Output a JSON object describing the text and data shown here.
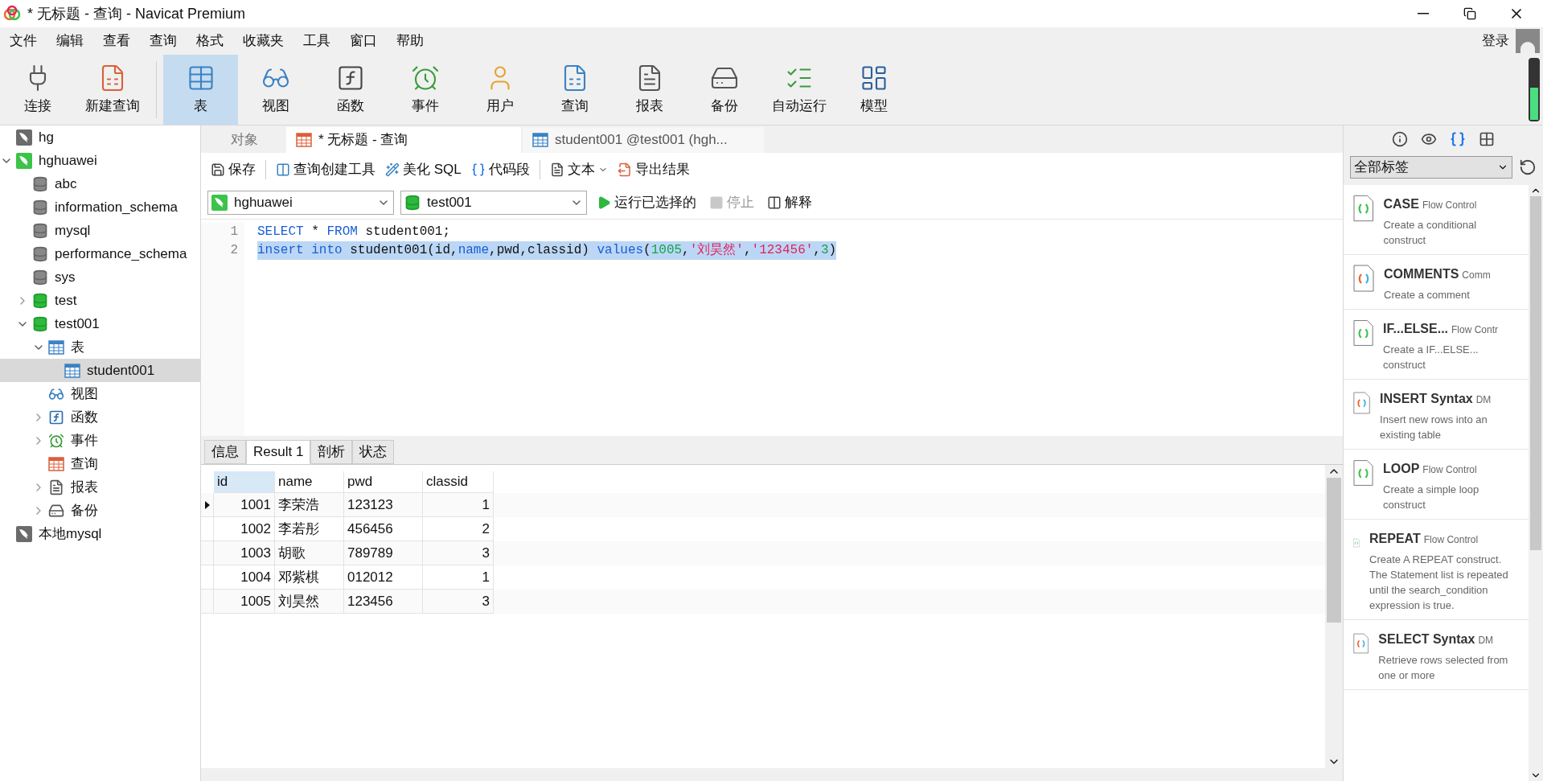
{
  "window": {
    "title": "* 无标题 - 查询 - Navicat Premium"
  },
  "menu": [
    "文件",
    "编辑",
    "查看",
    "查询",
    "格式",
    "收藏夹",
    "工具",
    "窗口",
    "帮助"
  ],
  "login": "登录",
  "toolbar": [
    {
      "kind": "connect",
      "label": "连接",
      "selected": false
    },
    {
      "kind": "new_query",
      "label": "新建查询",
      "selected": false
    },
    {
      "kind": "table",
      "label": "表",
      "selected": true
    },
    {
      "kind": "view",
      "label": "视图",
      "selected": false
    },
    {
      "kind": "function",
      "label": "函数",
      "selected": false
    },
    {
      "kind": "event",
      "label": "事件",
      "selected": false
    },
    {
      "kind": "user",
      "label": "用户",
      "selected": false
    },
    {
      "kind": "query",
      "label": "查询",
      "selected": false
    },
    {
      "kind": "report",
      "label": "报表",
      "selected": false
    },
    {
      "kind": "backup",
      "label": "备份",
      "selected": false
    },
    {
      "kind": "autorun",
      "label": "自动运行",
      "selected": false
    },
    {
      "kind": "model",
      "label": "模型",
      "selected": false
    }
  ],
  "tree": [
    {
      "kind": "connection",
      "label": "hg",
      "active": false,
      "selected": false
    },
    {
      "kind": "connection",
      "label": "hghuawei",
      "active": true,
      "expanded": true,
      "selected": false,
      "children": [
        {
          "kind": "database",
          "label": "abc",
          "active": false,
          "selected": false
        },
        {
          "kind": "database",
          "label": "information_schema",
          "active": false,
          "selected": false
        },
        {
          "kind": "database",
          "label": "mysql",
          "active": false,
          "selected": false
        },
        {
          "kind": "database",
          "label": "performance_schema",
          "active": false,
          "selected": false
        },
        {
          "kind": "database",
          "label": "sys",
          "active": false,
          "selected": false
        },
        {
          "kind": "database",
          "label": "test",
          "active": true,
          "expanded": false,
          "selected": false
        },
        {
          "kind": "database",
          "label": "test001",
          "active": true,
          "expanded": true,
          "selected": false,
          "children": [
            {
              "kind": "tables",
              "label": "表",
              "expanded": true,
              "selected": false,
              "children": [
                {
                  "kind": "table",
                  "label": "student001",
                  "selected": true
                }
              ]
            },
            {
              "kind": "views",
              "label": "视图",
              "selected": false
            },
            {
              "kind": "functions",
              "label": "函数",
              "expanded": false,
              "selected": false
            },
            {
              "kind": "events",
              "label": "事件",
              "expanded": false,
              "selected": false
            },
            {
              "kind": "queries",
              "label": "查询",
              "selected": false
            },
            {
              "kind": "reports",
              "label": "报表",
              "expanded": false,
              "selected": false
            },
            {
              "kind": "backups",
              "label": "备份",
              "expanded": false,
              "selected": false
            }
          ]
        }
      ]
    },
    {
      "kind": "connection",
      "label": "本地mysql",
      "active": false,
      "selected": false
    }
  ],
  "tabs": [
    {
      "kind": "objects",
      "label": "对象",
      "selected": false
    },
    {
      "kind": "query",
      "label": "* 无标题 - 查询",
      "selected": true
    },
    {
      "kind": "table",
      "label": "student001 @test001 (hgh...",
      "selected": false
    }
  ],
  "query_toolbar": [
    {
      "kind": "save",
      "label": "保存"
    },
    {
      "kind": "builder",
      "label": "查询创建工具"
    },
    {
      "kind": "beautify",
      "label": "美化 SQL"
    },
    {
      "kind": "snippet",
      "label": "代码段"
    },
    {
      "kind": "text",
      "label": "文本"
    },
    {
      "kind": "export",
      "label": "导出结果"
    }
  ],
  "connection_select": "hghuawei",
  "database_select": "test001",
  "run_actions": [
    {
      "kind": "run",
      "label": "运行已选择的",
      "disabled": false
    },
    {
      "kind": "stop",
      "label": "停止",
      "disabled": true
    },
    {
      "kind": "explain",
      "label": "解释",
      "disabled": false
    }
  ],
  "editor": {
    "lines": [
      {
        "number": "1",
        "selected": false,
        "tokens": [
          {
            "kind": "keyword",
            "text": "SELECT"
          },
          {
            "kind": "plain",
            "text": " * "
          },
          {
            "kind": "keyword",
            "text": "FROM"
          },
          {
            "kind": "plain",
            "text": " student001;"
          }
        ]
      },
      {
        "number": "2",
        "selected": true,
        "tokens": [
          {
            "kind": "keyword",
            "text": "insert into"
          },
          {
            "kind": "plain",
            "text": " student001(id,"
          },
          {
            "kind": "keyword",
            "text": "name"
          },
          {
            "kind": "plain",
            "text": ",pwd,classid) "
          },
          {
            "kind": "keyword",
            "text": "values"
          },
          {
            "kind": "plain",
            "text": "("
          },
          {
            "kind": "number",
            "text": "1005"
          },
          {
            "kind": "plain",
            "text": ","
          },
          {
            "kind": "string",
            "text": "'刘昊然'"
          },
          {
            "kind": "plain",
            "text": ","
          },
          {
            "kind": "string",
            "text": "'123456'"
          },
          {
            "kind": "plain",
            "text": ","
          },
          {
            "kind": "number",
            "text": "3"
          },
          {
            "kind": "plain",
            "text": ")"
          }
        ]
      }
    ]
  },
  "result_tabs": [
    {
      "label": "信息",
      "selected": false
    },
    {
      "label": "Result 1",
      "selected": true
    },
    {
      "label": "剖析",
      "selected": false
    },
    {
      "label": "状态",
      "selected": false
    }
  ],
  "table": {
    "columns": [
      {
        "label": "id",
        "selected": true,
        "kind": "number"
      },
      {
        "label": "name",
        "selected": false,
        "kind": "text"
      },
      {
        "label": "pwd",
        "selected": false,
        "kind": "text"
      },
      {
        "label": "classid",
        "selected": false,
        "kind": "number"
      }
    ],
    "rows": [
      {
        "current": true,
        "cells": [
          "1001",
          "李荣浩",
          "123123",
          "1"
        ]
      },
      {
        "current": false,
        "cells": [
          "1002",
          "李若彤",
          "456456",
          "2"
        ]
      },
      {
        "current": false,
        "cells": [
          "1003",
          "胡歌",
          "789789",
          "3"
        ]
      },
      {
        "current": false,
        "cells": [
          "1004",
          "邓紫棋",
          "012012",
          "1"
        ]
      },
      {
        "current": false,
        "cells": [
          "1005",
          "刘昊然",
          "123456",
          "3"
        ]
      }
    ]
  },
  "side_tabs": [
    {
      "kind": "info",
      "selected": false
    },
    {
      "kind": "preview",
      "selected": false
    },
    {
      "kind": "snippets",
      "selected": true
    },
    {
      "kind": "grid",
      "selected": false
    }
  ],
  "tag_select": "全部标签",
  "snippets": [
    {
      "kind": "flow",
      "title": "CASE",
      "tag": "Flow Control",
      "description": "Create a conditional construct"
    },
    {
      "kind": "multi",
      "title": "COMMENTS",
      "tag": "Comm",
      "description": "Create a comment"
    },
    {
      "kind": "flow",
      "title": "IF...ELSE...",
      "tag": "Flow Contr",
      "description": "Create a IF...ELSE... construct"
    },
    {
      "kind": "multi",
      "title": "INSERT Syntax",
      "tag": "DM",
      "description": "Insert new rows into an existing table"
    },
    {
      "kind": "flow",
      "title": "LOOP",
      "tag": "Flow Control",
      "description": "Create a simple loop construct"
    },
    {
      "kind": "flow",
      "title": "REPEAT",
      "tag": "Flow Control",
      "description": "Create A REPEAT construct. The Statement list is repeated until the search_condition expression is true."
    },
    {
      "kind": "multi",
      "title": "SELECT Syntax",
      "tag": "DM",
      "description": "Retrieve rows selected from one or more"
    }
  ]
}
